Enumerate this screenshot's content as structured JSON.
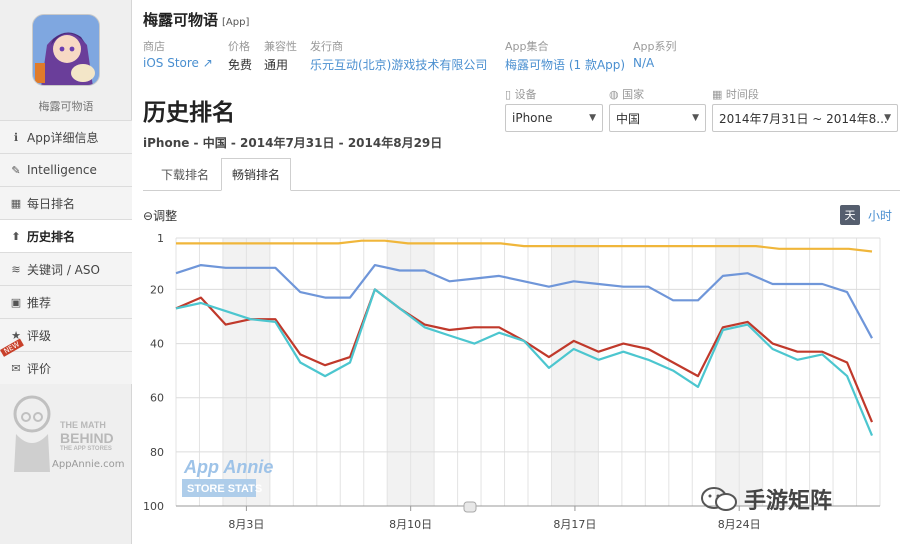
{
  "app": {
    "title": "梅露可物语",
    "tag": "[App]",
    "sidebar_name": "梅露可物语"
  },
  "meta": [
    {
      "label": "商店",
      "value": "iOS Store ↗",
      "link": true
    },
    {
      "label": "价格",
      "value": "免费",
      "link": false
    },
    {
      "label": "兼容性",
      "value": "通用",
      "link": false
    },
    {
      "label": "发行商",
      "value": "乐元互动(北京)游戏技术有限公司",
      "link": true
    },
    {
      "label": "App集合",
      "value": "梅露可物语 (1 款App)",
      "link": true
    },
    {
      "label": "App系列",
      "value": "N/A",
      "link": true
    }
  ],
  "nav": [
    {
      "label": "App详细信息",
      "icon": "info-icon",
      "glyph": "ℹ",
      "active": false
    },
    {
      "label": "Intelligence",
      "icon": "pencil-icon",
      "glyph": "✎",
      "active": false
    },
    {
      "label": "每日排名",
      "icon": "calendar-icon",
      "glyph": "▦",
      "active": false
    },
    {
      "label": "历史排名",
      "icon": "arrow-up-icon",
      "glyph": "⬆",
      "active": true
    },
    {
      "label": "关键词 / ASO",
      "icon": "signal-icon",
      "glyph": "≋",
      "active": false
    },
    {
      "label": "推荐",
      "icon": "bookmark-icon",
      "glyph": "▣",
      "active": false
    },
    {
      "label": "评级",
      "icon": "star-icon",
      "glyph": "★",
      "active": false
    },
    {
      "label": "评价",
      "icon": "comment-icon",
      "glyph": "✉",
      "active": false,
      "badge": "NEW"
    }
  ],
  "logo": {
    "line1": "THE MATH",
    "line2": "BEHIND",
    "line3": "THE APP STORES",
    "site": "AppAnnie.com"
  },
  "page": {
    "title": "历史排名",
    "subtitle": "iPhone - 中国 - 2014年7月31日 - 2014年8月29日"
  },
  "filters": {
    "device": {
      "label": "设备",
      "value": "iPhone"
    },
    "country": {
      "label": "国家",
      "value": "中国"
    },
    "period": {
      "label": "时间段",
      "value": "2014年7月31日 ~ 2014年8..."
    }
  },
  "tabs": [
    {
      "label": "下载排名",
      "active": false
    },
    {
      "label": "畅销排名",
      "active": true
    }
  ],
  "controls": {
    "zoom": "调整",
    "day": "天",
    "hour": "小时"
  },
  "chart_watermark": {
    "line1": "App Annie",
    "line2": "STORE STATS"
  },
  "watermark": "手游矩阵",
  "chart_data": {
    "type": "line",
    "y_reversed": true,
    "ylim": [
      1,
      100
    ],
    "yticks": [
      1,
      20,
      40,
      60,
      80,
      100
    ],
    "x_start_day": 31,
    "xticks": [
      {
        "day": 34,
        "label": "8月3日"
      },
      {
        "day": 41,
        "label": "8月10日"
      },
      {
        "day": 48,
        "label": "8月17日"
      },
      {
        "day": 55,
        "label": "8月24日"
      }
    ],
    "series": [
      {
        "color": "#f0b63a",
        "values": [
          3,
          3,
          3,
          3,
          3,
          3,
          3,
          3,
          2,
          2,
          3,
          3,
          3,
          3,
          3,
          4,
          4,
          4,
          4,
          4,
          4,
          4,
          4,
          4,
          4,
          4,
          5,
          5,
          5,
          5,
          6
        ]
      },
      {
        "color": "#6f96d9",
        "values": [
          14,
          11,
          12,
          12,
          12,
          21,
          23,
          23,
          11,
          13,
          13,
          17,
          16,
          15,
          17,
          19,
          17,
          18,
          19,
          19,
          24,
          24,
          15,
          14,
          18,
          18,
          18,
          21,
          38
        ]
      },
      {
        "color": "#c0392b",
        "values": [
          27,
          23,
          33,
          31,
          31,
          44,
          48,
          45,
          20,
          27,
          33,
          35,
          34,
          34,
          39,
          45,
          39,
          43,
          40,
          42,
          47,
          52,
          34,
          32,
          40,
          43,
          43,
          47,
          69
        ]
      },
      {
        "color": "#4cc6cf",
        "values": [
          27,
          25,
          28,
          31,
          32,
          47,
          52,
          47,
          20,
          27,
          34,
          37,
          40,
          36,
          39,
          49,
          42,
          46,
          43,
          46,
          50,
          56,
          35,
          33,
          42,
          46,
          44,
          52,
          74
        ]
      }
    ]
  }
}
